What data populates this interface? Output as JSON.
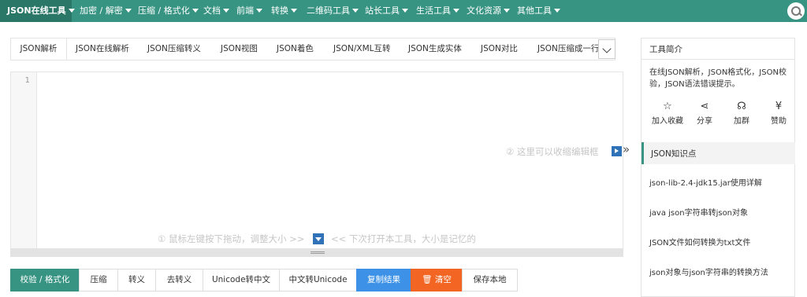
{
  "nav": {
    "items": [
      {
        "label": "JSON在线工具"
      },
      {
        "label": "加密 / 解密"
      },
      {
        "label": "压缩 / 格式化"
      },
      {
        "label": "文档"
      },
      {
        "label": "前端"
      },
      {
        "label": "转换"
      },
      {
        "label": "二维码工具"
      },
      {
        "label": "站长工具"
      },
      {
        "label": "生活工具"
      },
      {
        "label": "文化资源"
      },
      {
        "label": "其他工具"
      }
    ]
  },
  "tabs": [
    {
      "label": "JSON解析"
    },
    {
      "label": "JSON在线解析"
    },
    {
      "label": "JSON压缩转义"
    },
    {
      "label": "JSON视图"
    },
    {
      "label": "JSON着色"
    },
    {
      "label": "JSON/XML互转"
    },
    {
      "label": "JSON生成实体"
    },
    {
      "label": "JSON对比"
    },
    {
      "label": "JSON压缩成一行"
    }
  ],
  "editor": {
    "line_number": "1",
    "hint_collapse": "② 这里可以收缩编辑框",
    "hint_resize_left": "① 鼠标左键按下拖动，调整大小 >>",
    "hint_resize_right": "<< 下次打开本工具，大小是记忆的",
    "collapse_arrows": "»"
  },
  "actions": {
    "validate": "校验 / 格式化",
    "compress": "压缩",
    "escape": "转义",
    "unescape": "去转义",
    "unicode_to_cn": "Unicode转中文",
    "cn_to_unicode": "中文转Unicode",
    "copy": "复制结果",
    "clear": "清空",
    "save": "保存本地"
  },
  "panel": {
    "title": "工具简介",
    "description": "在线JSON解析，JSON格式化，JSON校验，JSON语法错误提示。",
    "actions": [
      {
        "icon": "☆",
        "label": "加入收藏"
      },
      {
        "icon": "⋖",
        "label": "分享"
      },
      {
        "icon": "☊",
        "label": "加群"
      },
      {
        "icon": "¥",
        "label": "赞助"
      }
    ],
    "knowledge_title": "JSON知识点",
    "knowledge_items": [
      "json-lib-2.4-jdk15.jar使用详解",
      "java json字符串转json对象",
      "JSON文件如何转换为txt文件",
      "json对象与json字符串的转换方法"
    ]
  },
  "colors": {
    "brand": "#389482",
    "copy": "#3d92e8",
    "clear": "#f26522",
    "hint_icon": "#2f72b8"
  }
}
